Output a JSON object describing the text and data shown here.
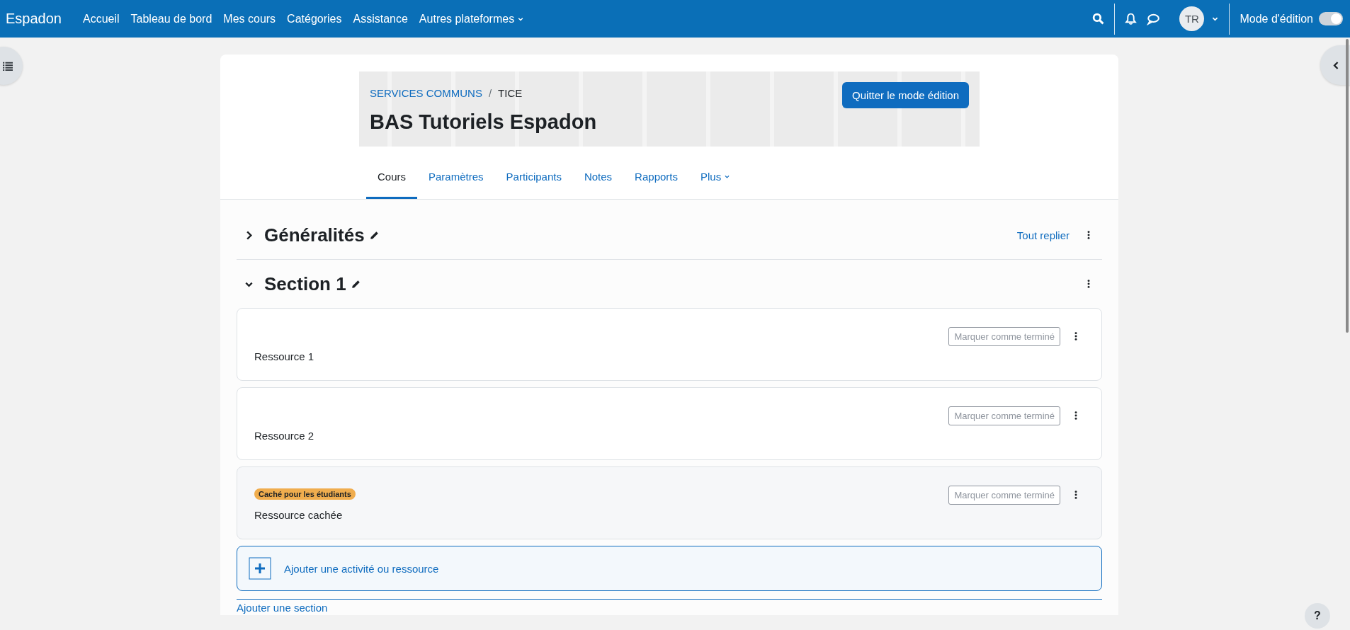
{
  "navbar": {
    "brand": "Espadon",
    "links": [
      {
        "label": "Accueil",
        "dropdown": false
      },
      {
        "label": "Tableau de bord",
        "dropdown": false
      },
      {
        "label": "Mes cours",
        "dropdown": false
      },
      {
        "label": "Catégories",
        "dropdown": false
      },
      {
        "label": "Assistance",
        "dropdown": false
      },
      {
        "label": "Autres plateformes",
        "dropdown": true
      }
    ],
    "avatar": "TR",
    "edit_mode": {
      "label": "Mode d'édition",
      "on": true
    }
  },
  "header": {
    "breadcrumb": [
      "SERVICES COMMUNS",
      "TICE"
    ],
    "breadcrumb_separator": "/",
    "title": "BAS Tutoriels Espadon",
    "edit_button": "Quitter le mode édition"
  },
  "tabs": [
    {
      "label": "Cours",
      "selected": true,
      "dropdown": false
    },
    {
      "label": "Paramètres",
      "selected": false,
      "dropdown": false
    },
    {
      "label": "Participants",
      "selected": false,
      "dropdown": false
    },
    {
      "label": "Notes",
      "selected": false,
      "dropdown": false
    },
    {
      "label": "Rapports",
      "selected": false,
      "dropdown": false
    },
    {
      "label": "Plus",
      "selected": false,
      "dropdown": true
    }
  ],
  "collapse_all": "Tout replier",
  "sections": [
    {
      "title": "Généralités",
      "expanded": false
    },
    {
      "title": "Section 1",
      "expanded": true,
      "activities": [
        {
          "name": "Ressource 1",
          "hidden": false,
          "completion_button": "Marquer comme terminé"
        },
        {
          "name": "Ressource 2",
          "hidden": false,
          "completion_button": "Marquer comme terminé"
        },
        {
          "name": "Ressource cachée",
          "hidden": true,
          "badge": "Caché pour les étudiants",
          "completion_button": "Marquer comme terminé"
        }
      ],
      "add_activity": "Ajouter une activité ou ressource"
    }
  ],
  "add_section": "Ajouter une section",
  "help_button": "?"
}
